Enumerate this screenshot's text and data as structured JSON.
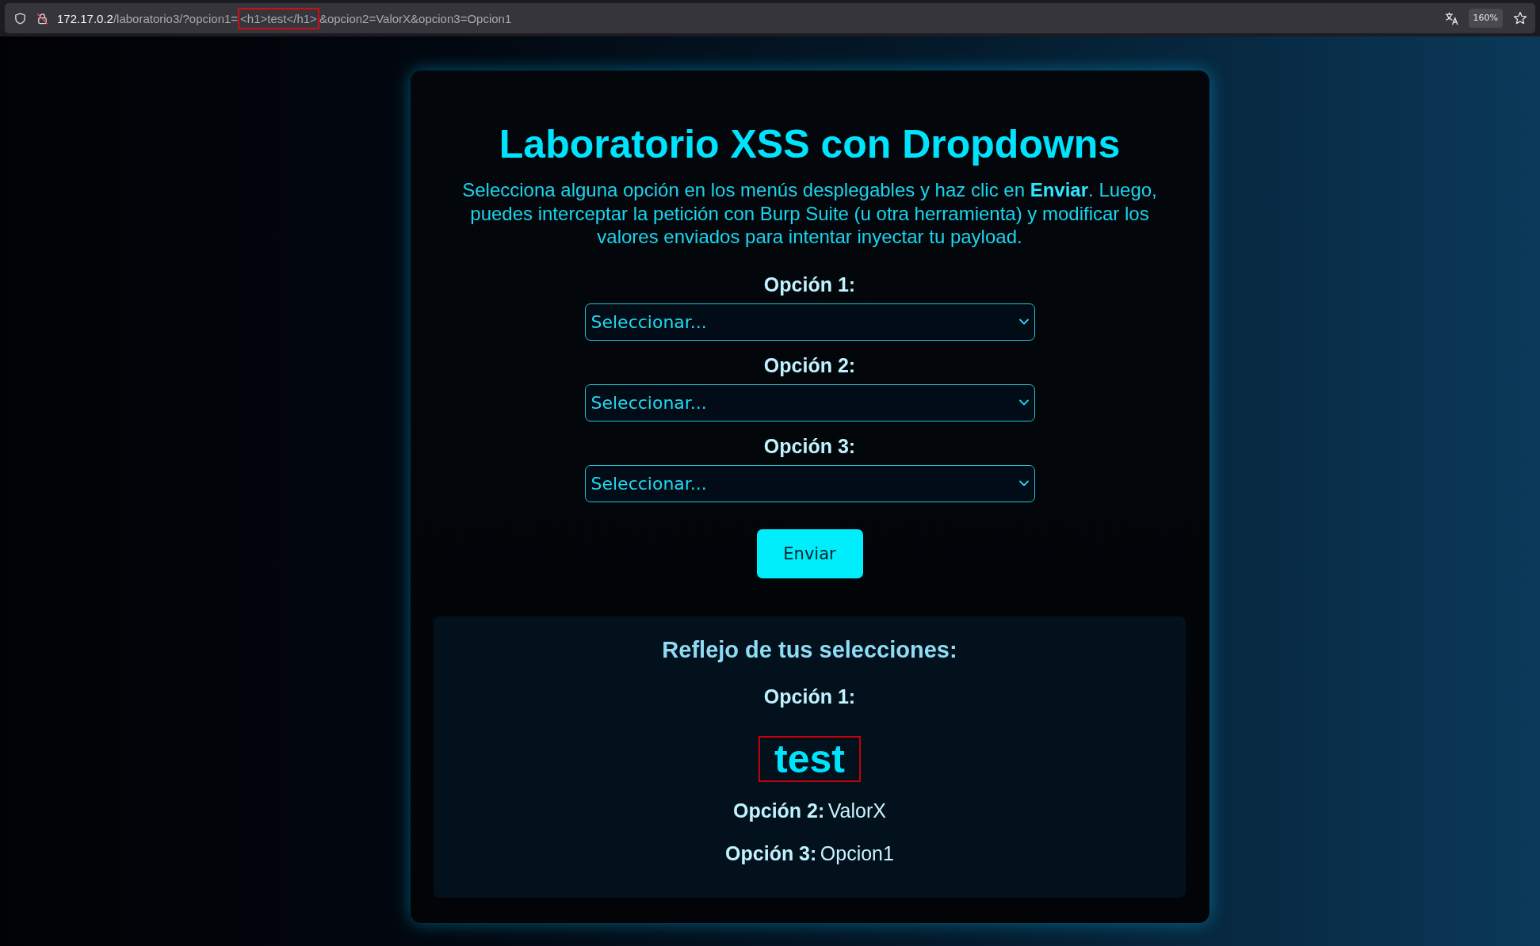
{
  "browser": {
    "url": [
      {
        "text": "172.17.0.2",
        "kind": "host",
        "highlighted": false
      },
      {
        "text": "/laboratorio3/?opcion1=",
        "kind": "path",
        "highlighted": false
      },
      {
        "text": "<h1>test</h1>",
        "kind": "path",
        "highlighted": true
      },
      {
        "text": "&opcion2=ValorX&opcion3=Opcion1",
        "kind": "path",
        "highlighted": false
      }
    ],
    "zoom": "160%"
  },
  "lab": {
    "title": "Laboratorio XSS con Dropdowns",
    "description": "Selecciona alguna opción en los menús desplegables y haz clic en **Enviar**. Luego, puedes interceptar la petición con Burp Suite (u otra herramienta) y modificar los valores enviados para intentar inyectar tu payload.",
    "fields": [
      {
        "label": "Opción 1:",
        "value": "Seleccionar..."
      },
      {
        "label": "Opción 2:",
        "value": "Seleccionar..."
      },
      {
        "label": "Opción 3:",
        "value": "Seleccionar..."
      }
    ],
    "submit": "Enviar"
  },
  "results": {
    "title": "Reflejo de tus selecciones:",
    "items": [
      {
        "kind": "block",
        "label": "Opción 1:",
        "value": "test",
        "highlighted": true
      },
      {
        "kind": "inline",
        "label": "Opción 2:",
        "value": "ValorX",
        "highlighted": false
      },
      {
        "kind": "inline",
        "label": "Opción 3:",
        "value": "Opcion1",
        "highlighted": false
      }
    ]
  }
}
